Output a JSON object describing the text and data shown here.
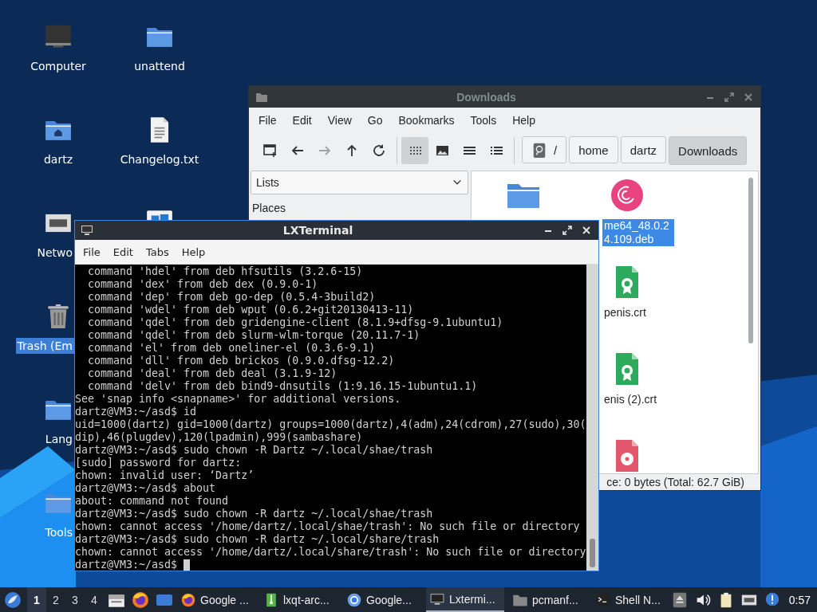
{
  "desktop": {
    "icons": [
      {
        "kind": "computer",
        "label": "Computer",
        "selected": false
      },
      {
        "kind": "folder",
        "label": "unattend",
        "selected": false
      },
      {
        "kind": "home",
        "label": "dartz",
        "selected": false
      },
      {
        "kind": "text",
        "label": "Changelog.txt",
        "selected": false
      },
      {
        "kind": "network",
        "label": "Netwo",
        "selected": false
      },
      {
        "kind": "tiles"
      },
      {
        "kind": "trash",
        "label": "Trash (Em",
        "selected": true
      },
      {
        "kind": "folder",
        "label": "Lang",
        "selected": false
      },
      {
        "kind": "folder",
        "label": "Tools",
        "selected": false
      }
    ]
  },
  "file_manager": {
    "title": "Downloads",
    "active": false,
    "menu": [
      "File",
      "Edit",
      "View",
      "Go",
      "Bookmarks",
      "Tools",
      "Help"
    ],
    "toolbar": [
      {
        "kind": "new-tab",
        "disabled": false
      },
      {
        "kind": "back",
        "disabled": false
      },
      {
        "kind": "forward",
        "disabled": true
      },
      {
        "kind": "up",
        "disabled": false
      },
      {
        "kind": "reload",
        "disabled": false
      }
    ],
    "view_modes": [
      {
        "kind": "icons",
        "selected": true
      },
      {
        "kind": "thumbnails",
        "selected": false
      },
      {
        "kind": "compact",
        "selected": false
      },
      {
        "kind": "details",
        "selected": false
      }
    ],
    "path": [
      {
        "label": "/",
        "selected": false
      },
      {
        "label": "home",
        "selected": false
      },
      {
        "label": "dartz",
        "selected": false
      },
      {
        "label": "Downloads",
        "selected": true
      }
    ],
    "side_pane": {
      "dropdown": "Lists",
      "heading": "Places"
    },
    "files": [
      {
        "kind": "folder"
      },
      {
        "kind": "deb",
        "label": "me64_48.0.2 4.109.deb",
        "selected": true
      },
      {
        "kind": "certificate",
        "label": "penis.crt",
        "selected": false
      },
      {
        "kind": "certificate",
        "label": "enis (2).crt",
        "selected": false
      },
      {
        "kind": "disc"
      }
    ],
    "status": "ce: 0 bytes (Total: 62.7 GiB)"
  },
  "terminal": {
    "title": "LXTerminal",
    "active": true,
    "menu": [
      "File",
      "Edit",
      "Tabs",
      "Help"
    ],
    "cursor_visible": true,
    "lines": [
      "  command 'hdel' from deb hfsutils (3.2.6-15)",
      "  command 'dex' from deb dex (0.9.0-1)",
      "  command 'dep' from deb go-dep (0.5.4-3build2)",
      "  command 'wdel' from deb wput (0.6.2+git20130413-11)",
      "  command 'qdel' from deb gridengine-client (8.1.9+dfsg-9.1ubuntu1)",
      "  command 'qdel' from deb slurm-wlm-torque (20.11.7-1)",
      "  command 'el' from deb oneliner-el (0.3.6-9.1)",
      "  command 'dll' from deb brickos (0.9.0.dfsg-12.2)",
      "  command 'deal' from deb deal (3.1.9-12)",
      "  command 'delv' from deb bind9-dnsutils (1:9.16.15-1ubuntu1.1)",
      "See 'snap info <snapname>' for additional versions.",
      "dartz@VM3:~/asd$ id",
      "uid=1000(dartz) gid=1000(dartz) groups=1000(dartz),4(adm),24(cdrom),27(sudo),30(",
      "dip),46(plugdev),120(lpadmin),999(sambashare)",
      "dartz@VM3:~/asd$ sudo chown -R Dartz ~/.local/shae/trash",
      "[sudo] password for dartz:",
      "chown: invalid user: ‘Dartz’",
      "dartz@VM3:~/asd$ about",
      "about: command not found",
      "dartz@VM3:~/asd$ sudo chown -R dartz ~/.local/shae/trash",
      "chown: cannot access '/home/dartz/.local/shae/trash': No such file or directory",
      "dartz@VM3:~/asd$ sudo chown -R dartz ~/.local/share/trash",
      "chown: cannot access '/home/dartz/.local/share/trash': No such file or directory",
      "dartz@VM3:~/asd$"
    ]
  },
  "taskbar": {
    "workspaces": [
      {
        "label": "1",
        "selected": true
      },
      {
        "label": "2",
        "selected": false
      },
      {
        "label": "3",
        "selected": false
      },
      {
        "label": "4",
        "selected": false
      }
    ],
    "launchers": [
      {
        "kind": "files"
      },
      {
        "kind": "browser"
      },
      {
        "kind": "desktop"
      }
    ],
    "tasks": [
      {
        "kind": "browser",
        "label": "Google ...",
        "selected": false
      },
      {
        "kind": "archive",
        "label": "lxqt-arc...",
        "selected": false
      },
      {
        "kind": "chrome",
        "label": "Google...",
        "selected": false
      },
      {
        "kind": "terminal",
        "label": "Lxtermi...",
        "selected": true
      },
      {
        "kind": "folder",
        "label": "pcmanf...",
        "selected": false
      },
      {
        "kind": "shell",
        "label": "Shell N...",
        "selected": false
      }
    ],
    "tray": [
      {
        "kind": "eject"
      },
      {
        "kind": "volume"
      },
      {
        "kind": "clipboard"
      },
      {
        "kind": "network"
      },
      {
        "kind": "alert"
      }
    ],
    "clock": "0:57"
  }
}
